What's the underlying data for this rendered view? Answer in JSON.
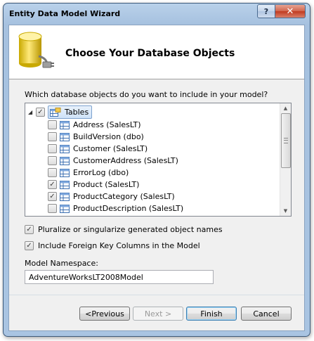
{
  "window": {
    "title": "Entity Data Model Wizard",
    "help_label": "?",
    "close_label": "✕"
  },
  "header": {
    "title": "Choose Your Database Objects",
    "icon": "database-connector-icon"
  },
  "question": "Which database objects do you want to include in your model?",
  "tree": {
    "root": {
      "label": "Tables",
      "checked": true,
      "expanded": true
    },
    "items": [
      {
        "label": "Address (SalesLT)",
        "checked": false
      },
      {
        "label": "BuildVersion (dbo)",
        "checked": false
      },
      {
        "label": "Customer (SalesLT)",
        "checked": false
      },
      {
        "label": "CustomerAddress (SalesLT)",
        "checked": false
      },
      {
        "label": "ErrorLog (dbo)",
        "checked": false
      },
      {
        "label": "Product (SalesLT)",
        "checked": true
      },
      {
        "label": "ProductCategory (SalesLT)",
        "checked": true
      },
      {
        "label": "ProductDescription (SalesLT)",
        "checked": false
      }
    ]
  },
  "options": {
    "pluralize": {
      "label": "Pluralize or singularize generated object names",
      "checked": true
    },
    "foreign_keys": {
      "label": "Include Foreign Key Columns in the Model",
      "checked": true
    }
  },
  "namespace": {
    "label": "Model Namespace:",
    "value": "AdventureWorksLT2008Model"
  },
  "buttons": {
    "previous": "<Previous",
    "next": "Next >",
    "finish": "Finish",
    "cancel": "Cancel"
  },
  "colors": {
    "titlebar": "#b9d1ea",
    "close_button": "#c13a1f",
    "client_background": "#f0f0f0"
  }
}
